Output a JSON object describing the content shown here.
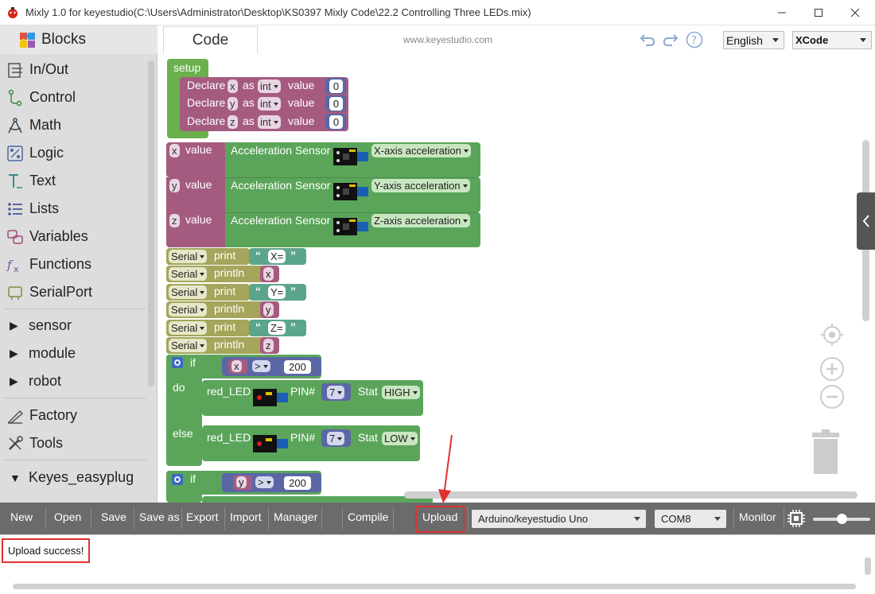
{
  "window": {
    "title": "Mixly 1.0 for keyestudio(C:\\Users\\Administrator\\Desktop\\KS0397 Mixly Code\\22.2 Controlling Three LEDs.mix)"
  },
  "sidebar": {
    "header": "Blocks",
    "items": [
      {
        "label": "In/Out",
        "icon": "in-out-icon"
      },
      {
        "label": "Control",
        "icon": "control-icon"
      },
      {
        "label": "Math",
        "icon": "math-icon"
      },
      {
        "label": "Logic",
        "icon": "logic-icon"
      },
      {
        "label": "Text",
        "icon": "text-icon"
      },
      {
        "label": "Lists",
        "icon": "lists-icon"
      },
      {
        "label": "Variables",
        "icon": "variables-icon"
      },
      {
        "label": "Functions",
        "icon": "functions-icon"
      },
      {
        "label": "SerialPort",
        "icon": "serialport-icon"
      }
    ],
    "groups": [
      "sensor",
      "module",
      "robot"
    ],
    "extra": [
      "Factory",
      "Tools"
    ],
    "expanded_group": "Keyes_easyplug"
  },
  "header": {
    "tab": "Code",
    "site": "www.keyestudio.com",
    "language": "English",
    "theme": "XCode"
  },
  "blocks": {
    "setup": "setup",
    "declares": [
      {
        "kw": "Declare",
        "var": "x",
        "as": "as",
        "type": "int",
        "value_kw": "value",
        "value": "0"
      },
      {
        "kw": "Declare",
        "var": "y",
        "as": "as",
        "type": "int",
        "value_kw": "value",
        "value": "0"
      },
      {
        "kw": "Declare",
        "var": "z",
        "as": "as",
        "type": "int",
        "value_kw": "value",
        "value": "0"
      }
    ],
    "assigns": [
      {
        "var": "x",
        "kw": "value",
        "sensor": "Acceleration Sensor",
        "axis": "X-axis acceleration"
      },
      {
        "var": "y",
        "kw": "value",
        "sensor": "Acceleration Sensor",
        "axis": "Y-axis acceleration"
      },
      {
        "var": "z",
        "kw": "value",
        "sensor": "Acceleration Sensor",
        "axis": "Z-axis acceleration"
      }
    ],
    "serial": [
      {
        "obj": "Serial",
        "fn": "print",
        "arg": "X=",
        "quoted": true
      },
      {
        "obj": "Serial",
        "fn": "println",
        "arg": "x",
        "quoted": false
      },
      {
        "obj": "Serial",
        "fn": "print",
        "arg": "Y=",
        "quoted": true
      },
      {
        "obj": "Serial",
        "fn": "println",
        "arg": "y",
        "quoted": false
      },
      {
        "obj": "Serial",
        "fn": "print",
        "arg": "Z=",
        "quoted": true
      },
      {
        "obj": "Serial",
        "fn": "println",
        "arg": "z",
        "quoted": false
      }
    ],
    "quote_open": "“",
    "quote_close": "”",
    "if1": {
      "kw_if": "if",
      "var": "x",
      "op": ">",
      "value": "200",
      "kw_do": "do",
      "kw_else": "else",
      "do_led": {
        "name": "red_LED",
        "pin_kw": "PIN#",
        "pin": "7",
        "stat_kw": "Stat",
        "stat": "HIGH"
      },
      "else_led": {
        "name": "red_LED",
        "pin_kw": "PIN#",
        "pin": "7",
        "stat_kw": "Stat",
        "stat": "LOW"
      }
    },
    "if2": {
      "kw_if": "if",
      "var": "y",
      "op": ">",
      "value": "200"
    }
  },
  "toolbar": {
    "buttons": [
      "New",
      "Open",
      "Save",
      "Save as",
      "Export",
      "Import",
      "Manager",
      "Compile",
      "Upload"
    ],
    "board": "Arduino/keyestudio Uno",
    "port": "COM8",
    "monitor": "Monitor"
  },
  "output": {
    "message": "Upload success!"
  },
  "colors": {
    "toolbar": "#6b6b6b",
    "sidebar": "#dddddd",
    "setup_block": "#6ab04c",
    "variable_block": "#a55b80",
    "sensor_block": "#5ba55b",
    "serial_block": "#a5a55b",
    "text_block": "#5ba58c",
    "logic_block": "#5b67a5",
    "highlight": "#e03030"
  }
}
